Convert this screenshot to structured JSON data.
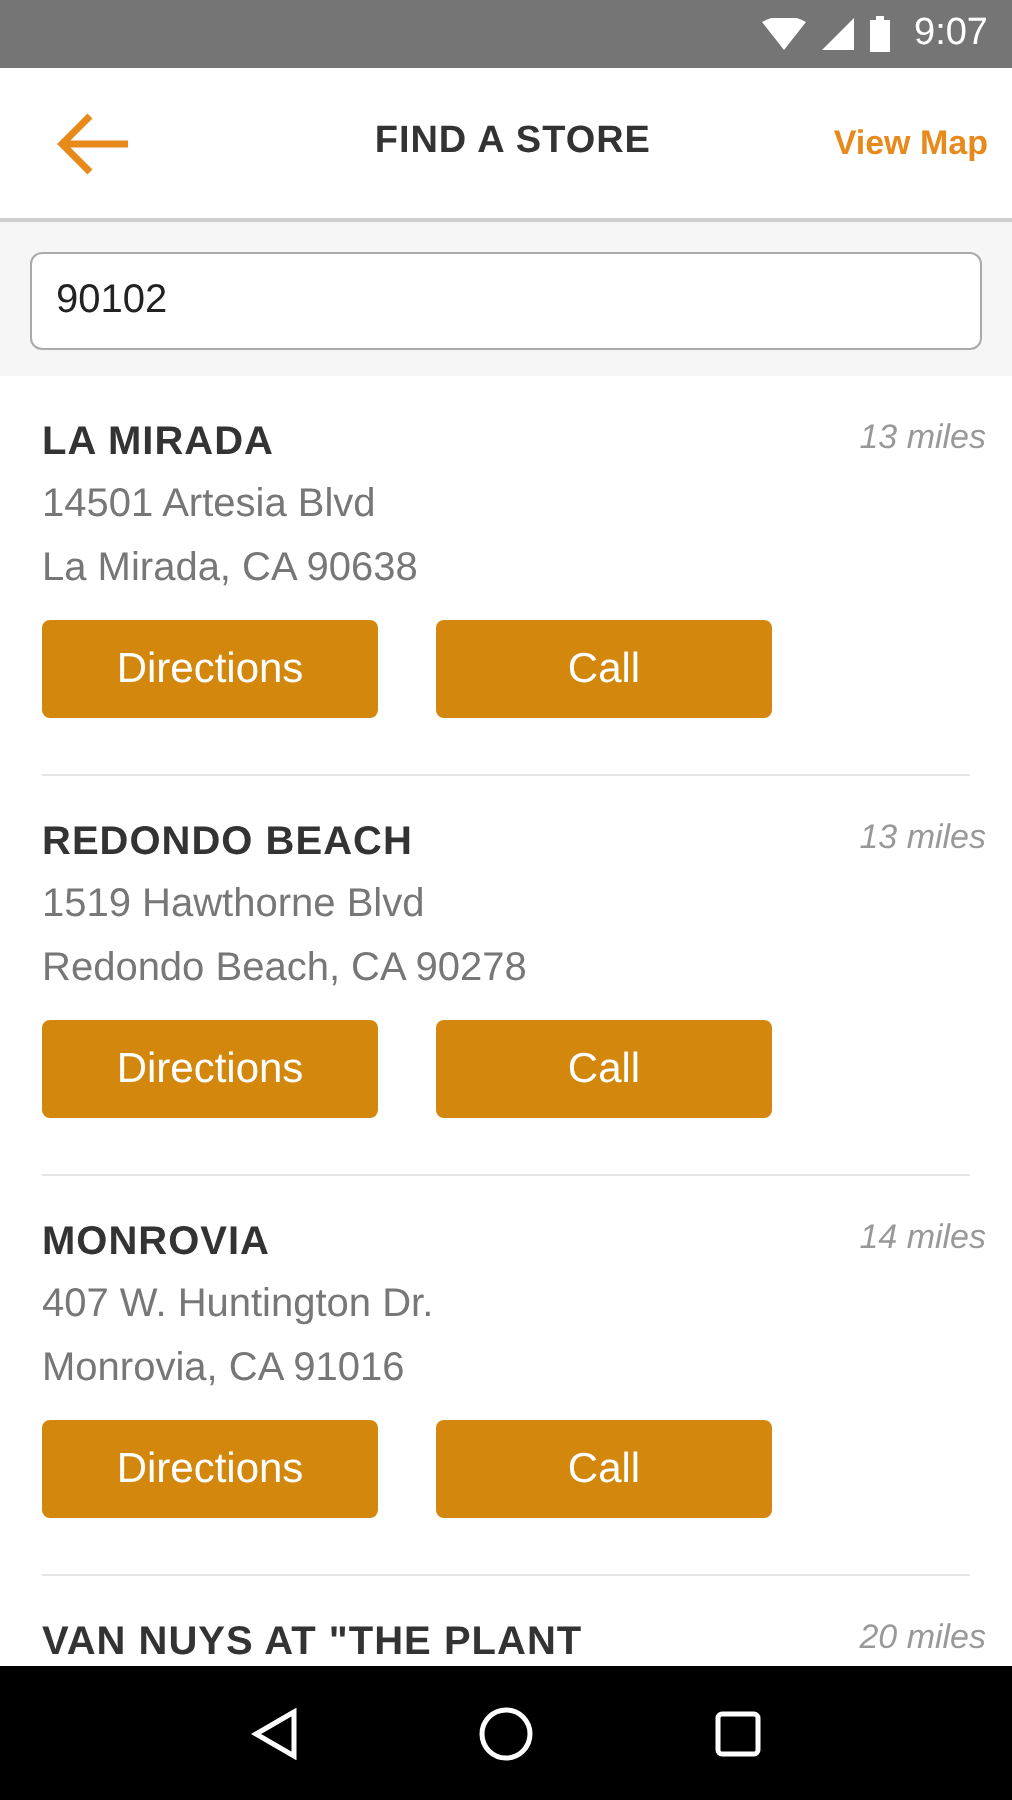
{
  "status_bar": {
    "time": "9:07"
  },
  "header": {
    "title": "FIND A STORE",
    "action": "View Map"
  },
  "search": {
    "value": "90102"
  },
  "stores": [
    {
      "name": "LA MIRADA",
      "distance": "13 miles",
      "address_line_1": "14501 Artesia Blvd",
      "address_line_2": "La Mirada, CA 90638",
      "buttons": [
        "Directions",
        "Call"
      ]
    },
    {
      "name": "REDONDO BEACH",
      "distance": "13 miles",
      "address_line_1": "1519 Hawthorne Blvd",
      "address_line_2": "Redondo Beach, CA 90278",
      "buttons": [
        "Directions",
        "Call"
      ]
    },
    {
      "name": "MONROVIA",
      "distance": "14 miles",
      "address_line_1": "407 W. Huntington Dr.",
      "address_line_2": "Monrovia, CA 91016",
      "buttons": [
        "Directions",
        "Call"
      ]
    },
    {
      "name": "VAN NUYS AT \"THE PLANT",
      "distance": "20 miles"
    }
  ]
}
